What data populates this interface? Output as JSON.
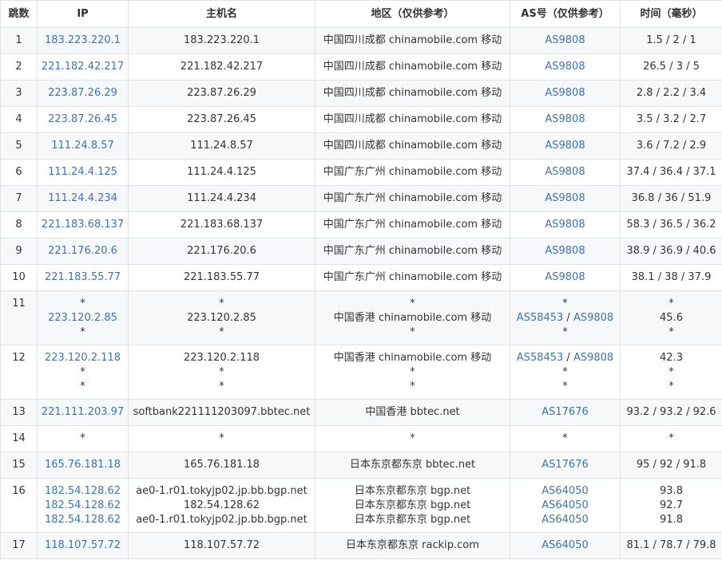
{
  "headers": {
    "hop": "跳数",
    "ip": "IP",
    "host": "主机名",
    "region": "地区（仅供参考）",
    "as": "AS号（仅供参考）",
    "time": "时间（毫秒）"
  },
  "colors": {
    "link": "#3b73b9",
    "border": "#dfe2e5",
    "stripe": "#f6f8fa"
  },
  "rows": [
    {
      "hop": "1",
      "ip": [
        "183.223.220.1"
      ],
      "host": [
        "183.223.220.1"
      ],
      "region": [
        "中国四川成都 chinamobile.com 移动"
      ],
      "as": [
        [
          "AS9808"
        ]
      ],
      "time": [
        "1.5 / 2 / 1"
      ]
    },
    {
      "hop": "2",
      "ip": [
        "221.182.42.217"
      ],
      "host": [
        "221.182.42.217"
      ],
      "region": [
        "中国四川成都 chinamobile.com 移动"
      ],
      "as": [
        [
          "AS9808"
        ]
      ],
      "time": [
        "26.5 / 3 / 5"
      ]
    },
    {
      "hop": "3",
      "ip": [
        "223.87.26.29"
      ],
      "host": [
        "223.87.26.29"
      ],
      "region": [
        "中国四川成都 chinamobile.com 移动"
      ],
      "as": [
        [
          "AS9808"
        ]
      ],
      "time": [
        "2.8 / 2.2 / 3.4"
      ]
    },
    {
      "hop": "4",
      "ip": [
        "223.87.26.45"
      ],
      "host": [
        "223.87.26.45"
      ],
      "region": [
        "中国四川成都 chinamobile.com 移动"
      ],
      "as": [
        [
          "AS9808"
        ]
      ],
      "time": [
        "3.5 / 3.2 / 2.7"
      ]
    },
    {
      "hop": "5",
      "ip": [
        "111.24.8.57"
      ],
      "host": [
        "111.24.8.57"
      ],
      "region": [
        "中国四川成都 chinamobile.com 移动"
      ],
      "as": [
        [
          "AS9808"
        ]
      ],
      "time": [
        "3.6 / 7.2 / 2.9"
      ]
    },
    {
      "hop": "6",
      "ip": [
        "111.24.4.125"
      ],
      "host": [
        "111.24.4.125"
      ],
      "region": [
        "中国广东广州 chinamobile.com 移动"
      ],
      "as": [
        [
          "AS9808"
        ]
      ],
      "time": [
        "37.4 / 36.4 / 37.1"
      ]
    },
    {
      "hop": "7",
      "ip": [
        "111.24.4.234"
      ],
      "host": [
        "111.24.4.234"
      ],
      "region": [
        "中国广东广州 chinamobile.com 移动"
      ],
      "as": [
        [
          "AS9808"
        ]
      ],
      "time": [
        "36.8 / 36 / 51.9"
      ]
    },
    {
      "hop": "8",
      "ip": [
        "221.183.68.137"
      ],
      "host": [
        "221.183.68.137"
      ],
      "region": [
        "中国广东广州 chinamobile.com 移动"
      ],
      "as": [
        [
          "AS9808"
        ]
      ],
      "time": [
        "58.3 / 36.5 / 36.2"
      ]
    },
    {
      "hop": "9",
      "ip": [
        "221.176.20.6"
      ],
      "host": [
        "221.176.20.6"
      ],
      "region": [
        "中国广东广州 chinamobile.com 移动"
      ],
      "as": [
        [
          "AS9808"
        ]
      ],
      "time": [
        "38.9 / 36.9 / 40.6"
      ]
    },
    {
      "hop": "10",
      "ip": [
        "221.183.55.77"
      ],
      "host": [
        "221.183.55.77"
      ],
      "region": [
        "中国广东广州 chinamobile.com 移动"
      ],
      "as": [
        [
          "AS9808"
        ]
      ],
      "time": [
        "38.1 / 38 / 37.9"
      ]
    },
    {
      "hop": "11",
      "ip": [
        "*",
        "223.120.2.85",
        "*"
      ],
      "host": [
        "*",
        "223.120.2.85",
        "*"
      ],
      "region": [
        "*",
        "中国香港 chinamobile.com 移动",
        "*"
      ],
      "as": [
        [
          "*"
        ],
        [
          "AS58453",
          "AS9808"
        ],
        [
          "*"
        ]
      ],
      "time": [
        "*",
        "45.6",
        "*"
      ]
    },
    {
      "hop": "12",
      "ip": [
        "223.120.2.118",
        "*",
        "*"
      ],
      "host": [
        "223.120.2.118",
        "*",
        "*"
      ],
      "region": [
        "中国香港 chinamobile.com 移动",
        "*",
        "*"
      ],
      "as": [
        [
          "AS58453",
          "AS9808"
        ],
        [
          "*"
        ],
        [
          "*"
        ]
      ],
      "time": [
        "42.3",
        "*",
        "*"
      ]
    },
    {
      "hop": "13",
      "ip": [
        "221.111.203.97"
      ],
      "host": [
        "softbank221111203097.bbtec.net"
      ],
      "region": [
        "中国香港 bbtec.net"
      ],
      "as": [
        [
          "AS17676"
        ]
      ],
      "time": [
        "93.2 / 93.2 / 92.6"
      ]
    },
    {
      "hop": "14",
      "ip": [
        "*"
      ],
      "host": [
        "*"
      ],
      "region": [
        "*"
      ],
      "as": [
        [
          "*"
        ]
      ],
      "time": [
        "*"
      ]
    },
    {
      "hop": "15",
      "ip": [
        "165.76.181.18"
      ],
      "host": [
        "165.76.181.18"
      ],
      "region": [
        "日本东京都东京 bbtec.net"
      ],
      "as": [
        [
          "AS17676"
        ]
      ],
      "time": [
        "95 / 92 / 91.8"
      ]
    },
    {
      "hop": "16",
      "ip": [
        "182.54.128.62",
        "182.54.128.62",
        "182.54.128.62"
      ],
      "host": [
        "ae0-1.r01.tokyjp02.jp.bb.bgp.net",
        "182.54.128.62",
        "ae0-1.r01.tokyjp02.jp.bb.bgp.net"
      ],
      "region": [
        "日本东京都东京 bgp.net",
        "日本东京都东京 bgp.net",
        "日本东京都东京 bgp.net"
      ],
      "as": [
        [
          "AS64050"
        ],
        [
          "AS64050"
        ],
        [
          "AS64050"
        ]
      ],
      "time": [
        "93.8",
        "92.7",
        "91.8"
      ]
    },
    {
      "hop": "17",
      "ip": [
        "118.107.57.72"
      ],
      "host": [
        "118.107.57.72"
      ],
      "region": [
        "日本东京都东京 rackip.com"
      ],
      "as": [
        [
          "AS64050"
        ]
      ],
      "time": [
        "81.1 / 78.7 / 79.8"
      ]
    }
  ]
}
